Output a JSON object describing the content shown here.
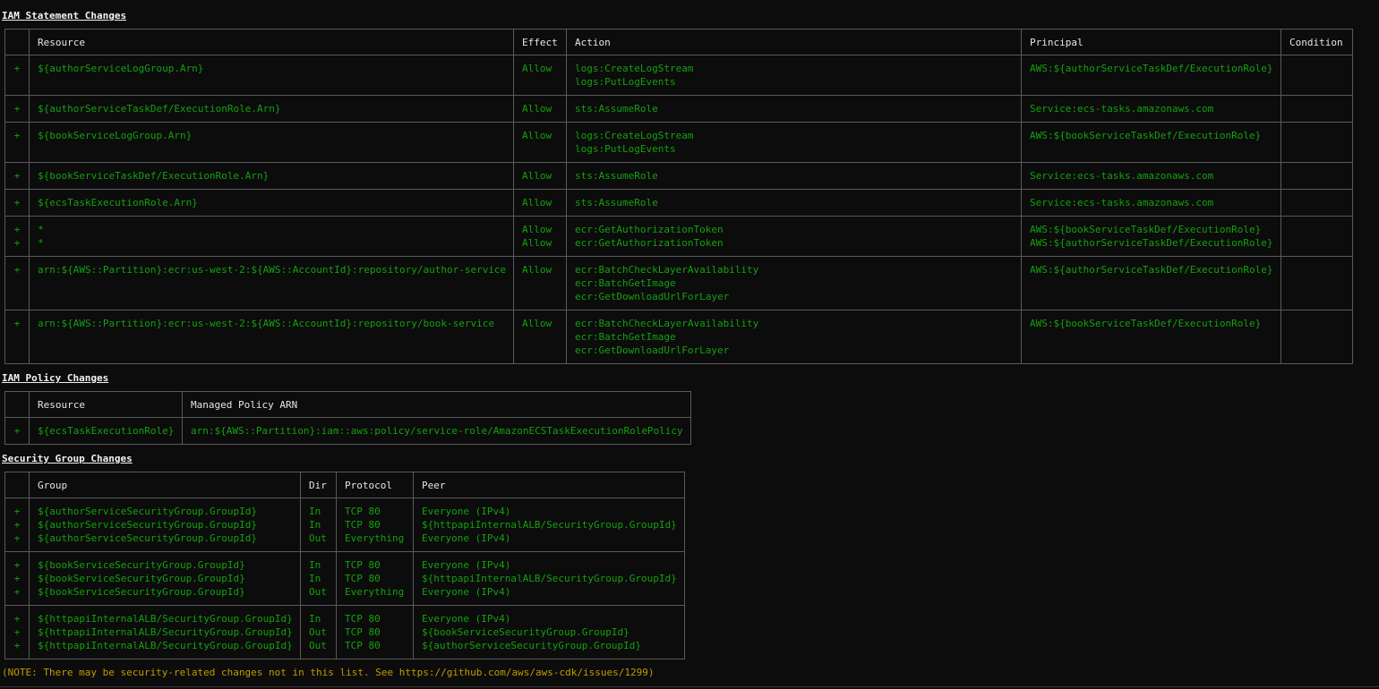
{
  "iam_statement": {
    "title": "IAM Statement Changes",
    "headers": [
      "",
      "Resource",
      "Effect",
      "Action",
      "Principal",
      "Condition"
    ],
    "rows": [
      {
        "plus": [
          "+"
        ],
        "resource": [
          "${authorServiceLogGroup.Arn}"
        ],
        "effect": [
          "Allow"
        ],
        "action": [
          "logs:CreateLogStream",
          "logs:PutLogEvents"
        ],
        "principal": [
          "AWS:${authorServiceTaskDef/ExecutionRole}"
        ],
        "condition": []
      },
      {
        "plus": [
          "+"
        ],
        "resource": [
          "${authorServiceTaskDef/ExecutionRole.Arn}"
        ],
        "effect": [
          "Allow"
        ],
        "action": [
          "sts:AssumeRole"
        ],
        "principal": [
          "Service:ecs-tasks.amazonaws.com"
        ],
        "condition": []
      },
      {
        "plus": [
          "+"
        ],
        "resource": [
          "${bookServiceLogGroup.Arn}"
        ],
        "effect": [
          "Allow"
        ],
        "action": [
          "logs:CreateLogStream",
          "logs:PutLogEvents"
        ],
        "principal": [
          "AWS:${bookServiceTaskDef/ExecutionRole}"
        ],
        "condition": []
      },
      {
        "plus": [
          "+"
        ],
        "resource": [
          "${bookServiceTaskDef/ExecutionRole.Arn}"
        ],
        "effect": [
          "Allow"
        ],
        "action": [
          "sts:AssumeRole"
        ],
        "principal": [
          "Service:ecs-tasks.amazonaws.com"
        ],
        "condition": []
      },
      {
        "plus": [
          "+"
        ],
        "resource": [
          "${ecsTaskExecutionRole.Arn}"
        ],
        "effect": [
          "Allow"
        ],
        "action": [
          "sts:AssumeRole"
        ],
        "principal": [
          "Service:ecs-tasks.amazonaws.com"
        ],
        "condition": []
      },
      {
        "plus": [
          "+",
          "+"
        ],
        "resource": [
          "*",
          "*"
        ],
        "effect": [
          "Allow",
          "Allow"
        ],
        "action": [
          "ecr:GetAuthorizationToken",
          "ecr:GetAuthorizationToken"
        ],
        "principal": [
          "AWS:${bookServiceTaskDef/ExecutionRole}",
          "AWS:${authorServiceTaskDef/ExecutionRole}"
        ],
        "condition": []
      },
      {
        "plus": [
          "+"
        ],
        "resource": [
          "arn:${AWS::Partition}:ecr:us-west-2:${AWS::AccountId}:repository/author-service"
        ],
        "effect": [
          "Allow"
        ],
        "action": [
          "ecr:BatchCheckLayerAvailability",
          "ecr:BatchGetImage",
          "ecr:GetDownloadUrlForLayer"
        ],
        "principal": [
          "AWS:${authorServiceTaskDef/ExecutionRole}"
        ],
        "condition": []
      },
      {
        "plus": [
          "+"
        ],
        "resource": [
          "arn:${AWS::Partition}:ecr:us-west-2:${AWS::AccountId}:repository/book-service"
        ],
        "effect": [
          "Allow"
        ],
        "action": [
          "ecr:BatchCheckLayerAvailability",
          "ecr:BatchGetImage",
          "ecr:GetDownloadUrlForLayer"
        ],
        "principal": [
          "AWS:${bookServiceTaskDef/ExecutionRole}"
        ],
        "condition": []
      }
    ]
  },
  "iam_policy": {
    "title": "IAM Policy Changes",
    "headers": [
      "",
      "Resource",
      "Managed Policy ARN"
    ],
    "rows": [
      {
        "plus": [
          "+"
        ],
        "resource": [
          "${ecsTaskExecutionRole}"
        ],
        "arn": [
          "arn:${AWS::Partition}:iam::aws:policy/service-role/AmazonECSTaskExecutionRolePolicy"
        ]
      }
    ]
  },
  "security_group": {
    "title": "Security Group Changes",
    "headers": [
      "",
      "Group",
      "Dir",
      "Protocol",
      "Peer"
    ],
    "rows": [
      {
        "plus": [
          "+",
          "+",
          "+"
        ],
        "group": [
          "${authorServiceSecurityGroup.GroupId}",
          "${authorServiceSecurityGroup.GroupId}",
          "${authorServiceSecurityGroup.GroupId}"
        ],
        "dir": [
          "In",
          "In",
          "Out"
        ],
        "protocol": [
          "TCP 80",
          "TCP 80",
          "Everything"
        ],
        "peer": [
          "Everyone (IPv4)",
          "${httpapiInternalALB/SecurityGroup.GroupId}",
          "Everyone (IPv4)"
        ]
      },
      {
        "plus": [
          "+",
          "+",
          "+"
        ],
        "group": [
          "${bookServiceSecurityGroup.GroupId}",
          "${bookServiceSecurityGroup.GroupId}",
          "${bookServiceSecurityGroup.GroupId}"
        ],
        "dir": [
          "In",
          "In",
          "Out"
        ],
        "protocol": [
          "TCP 80",
          "TCP 80",
          "Everything"
        ],
        "peer": [
          "Everyone (IPv4)",
          "${httpapiInternalALB/SecurityGroup.GroupId}",
          "Everyone (IPv4)"
        ]
      },
      {
        "plus": [
          "+",
          "+",
          "+"
        ],
        "group": [
          "${httpapiInternalALB/SecurityGroup.GroupId}",
          "${httpapiInternalALB/SecurityGroup.GroupId}",
          "${httpapiInternalALB/SecurityGroup.GroupId}"
        ],
        "dir": [
          "In",
          "Out",
          "Out"
        ],
        "protocol": [
          "TCP 80",
          "TCP 80",
          "TCP 80"
        ],
        "peer": [
          "Everyone (IPv4)",
          "${bookServiceSecurityGroup.GroupId}",
          "${authorServiceSecurityGroup.GroupId}"
        ]
      }
    ]
  },
  "note": "(NOTE: There may be security-related changes not in this list. See https://github.com/aws/aws-cdk/issues/1299)",
  "colors": {
    "background": "#0c0c0c",
    "added": "#13a10e",
    "heading": "#f2f2f2",
    "note": "#c19c00",
    "border": "#5a5a5a"
  }
}
